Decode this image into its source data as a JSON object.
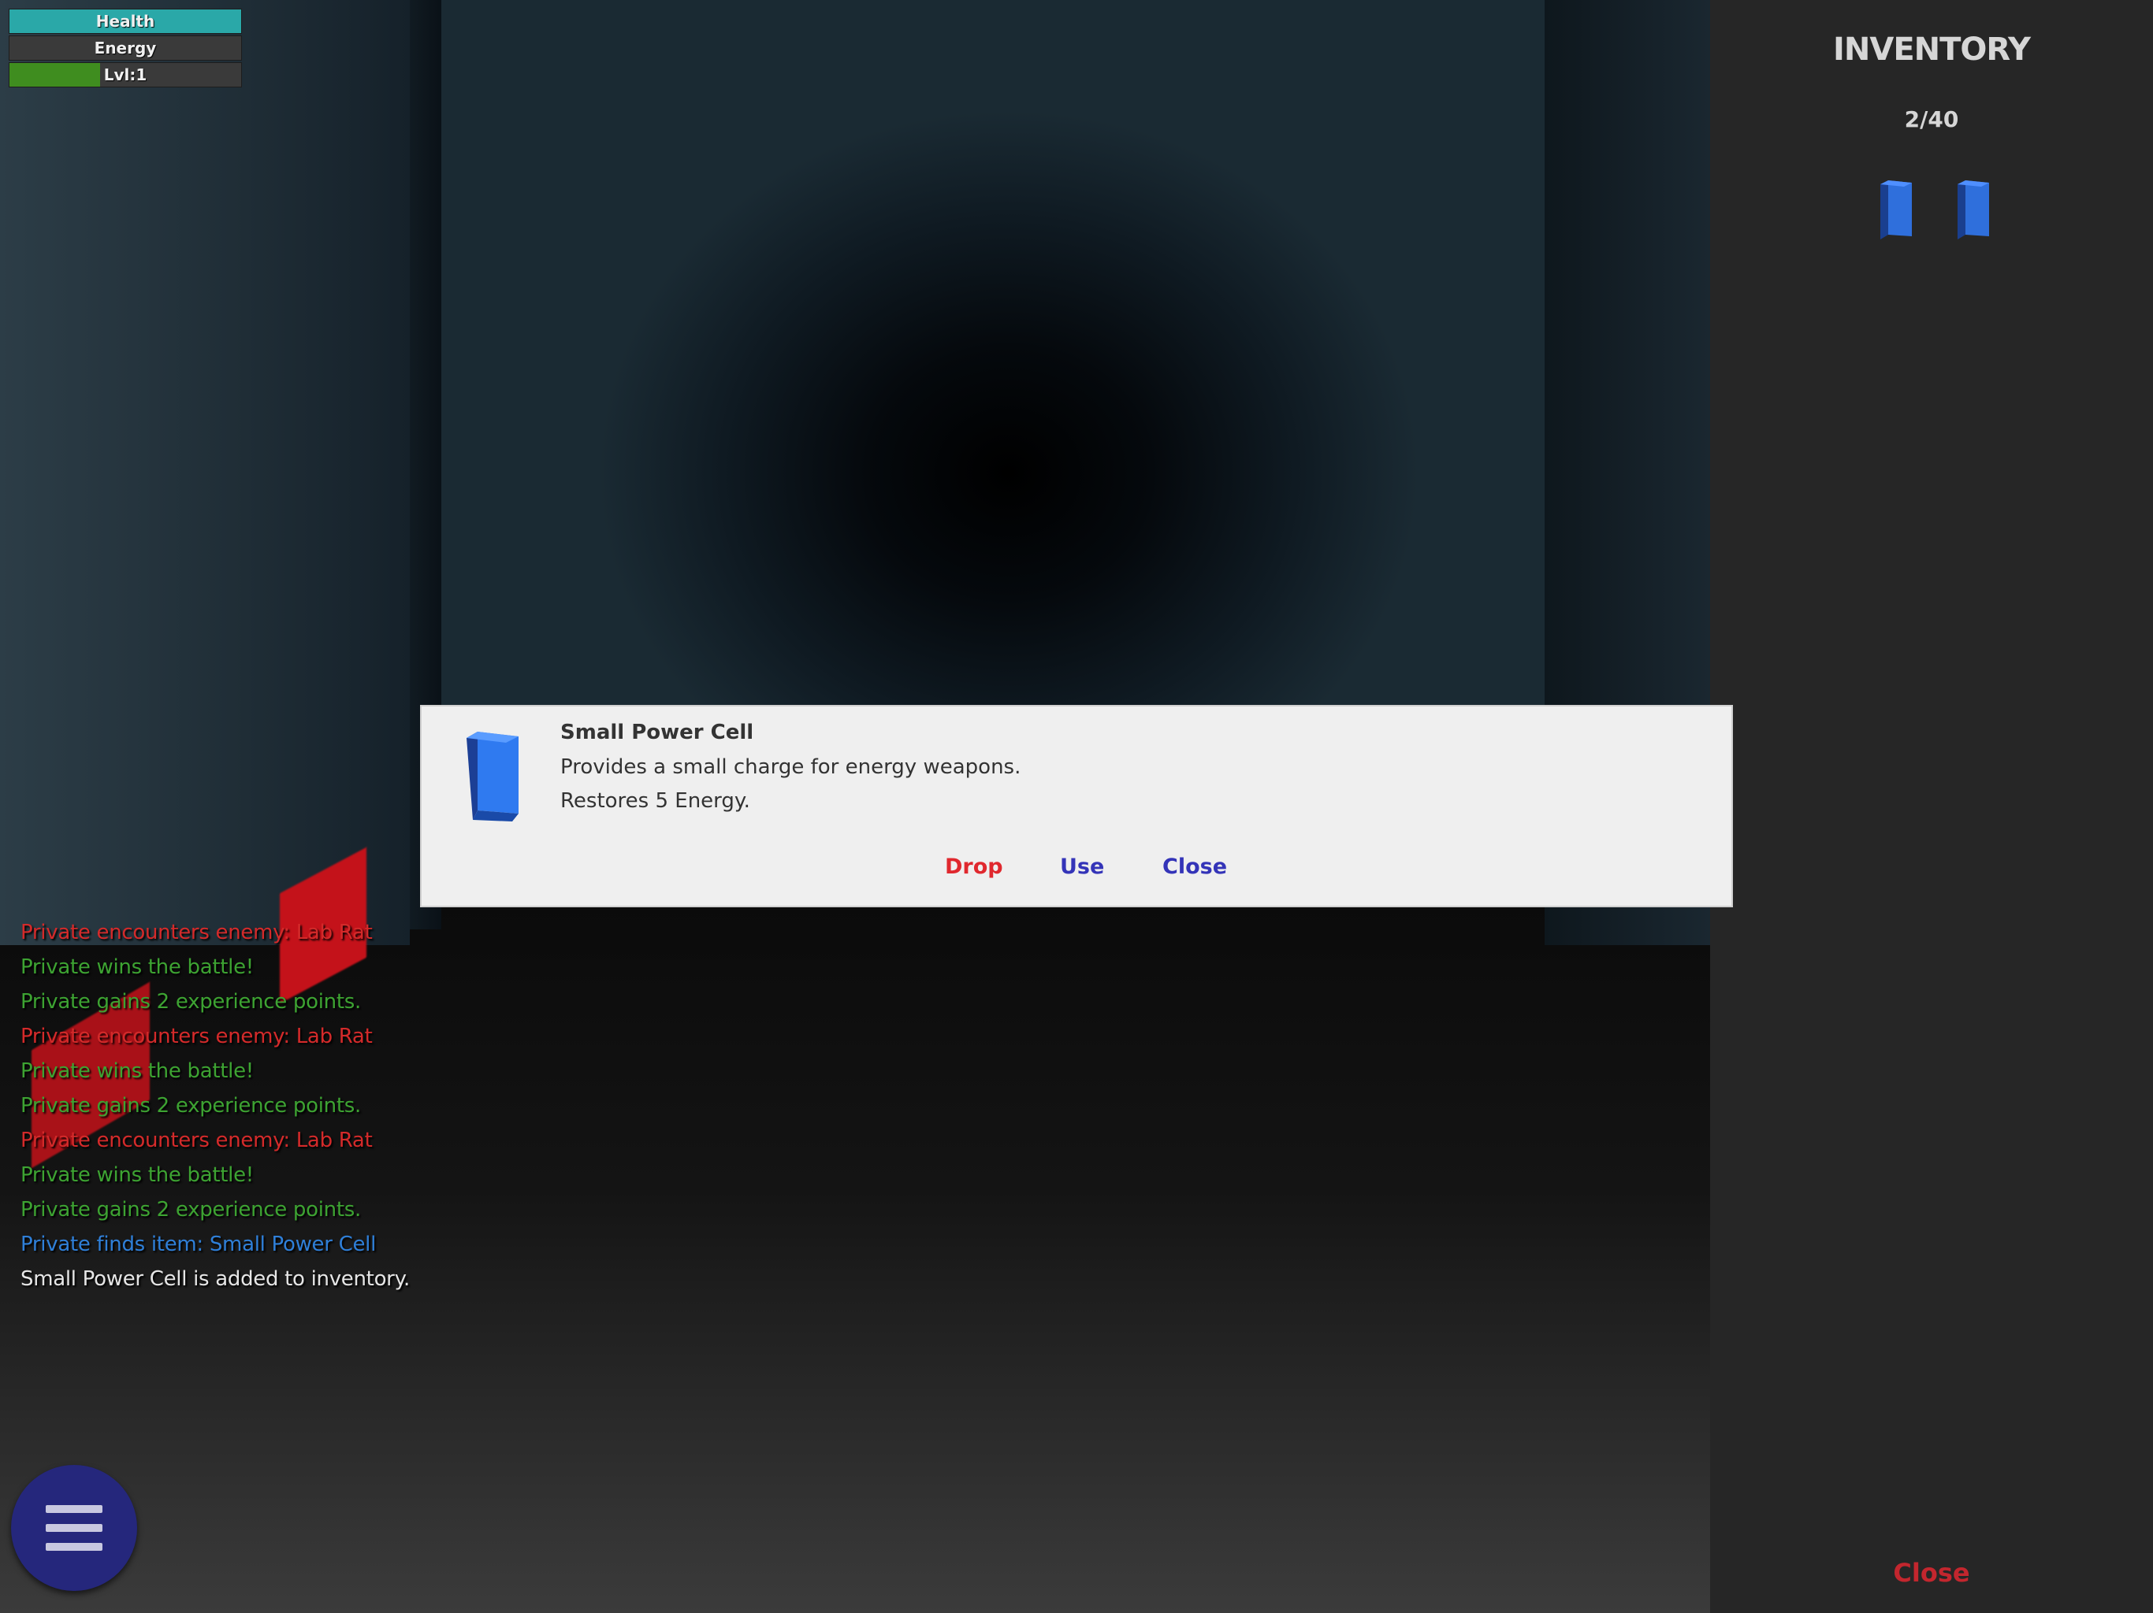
{
  "hud": {
    "health": {
      "label": "Health",
      "value": 1.0,
      "color": "#2aa8a8"
    },
    "energy": {
      "label": "Energy",
      "value": 0.0,
      "color": "#2a6fa8"
    },
    "level": {
      "label": "Lvl:1",
      "value": 0.39,
      "color": "#3f8d1f"
    }
  },
  "log": {
    "lines": [
      {
        "text": "Private encounters enemy: Lab Rat",
        "color": "#d42a2a"
      },
      {
        "text": "Private wins the battle!",
        "color": "#3da332"
      },
      {
        "text": "Private gains 2 experience points.",
        "color": "#3da332"
      },
      {
        "text": "Private encounters enemy: Lab Rat",
        "color": "#d42a2a"
      },
      {
        "text": "Private wins the battle!",
        "color": "#3da332"
      },
      {
        "text": "Private gains 2 experience points.",
        "color": "#3da332"
      },
      {
        "text": "Private encounters enemy: Lab Rat",
        "color": "#d42a2a"
      },
      {
        "text": "Private wins the battle!",
        "color": "#3da332"
      },
      {
        "text": "Private gains 2 experience points.",
        "color": "#3da332"
      },
      {
        "text": "Private finds item: Small Power Cell",
        "color": "#2f7fd8"
      },
      {
        "text": "Small Power Cell is added to inventory.",
        "color": "#e6e6e6"
      }
    ]
  },
  "menu": {
    "icon": "hamburger-menu-icon"
  },
  "inventory": {
    "title": "INVENTORY",
    "count": "2/40",
    "items": [
      {
        "icon": "power-cell-icon"
      },
      {
        "icon": "power-cell-icon"
      }
    ],
    "close_label": "Close"
  },
  "dialog": {
    "icon": "power-cell-icon",
    "name": "Small Power Cell",
    "description": "Provides a small charge for energy weapons.",
    "effect": "Restores 5 Energy.",
    "drop_label": "Drop",
    "use_label": "Use",
    "close_label": "Close"
  }
}
